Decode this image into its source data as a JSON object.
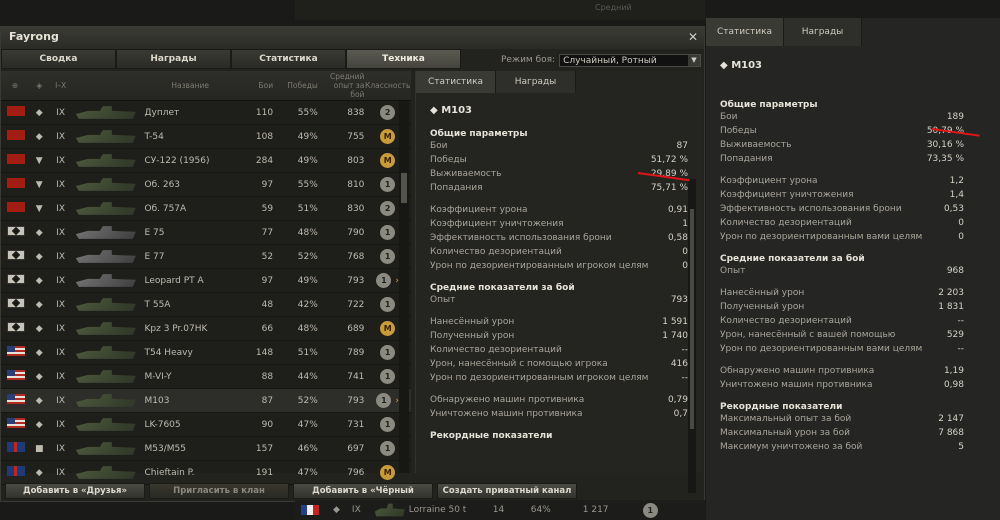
{
  "window": {
    "title": "Fayrong"
  },
  "tabs": [
    "Сводка",
    "Награды",
    "Статистика",
    "Техника"
  ],
  "mode": {
    "label": "Режим боя:",
    "value": "Случайный, Ротный"
  },
  "columns": {
    "tier": "I–X",
    "name": "Название",
    "battles": "Бои",
    "wins": "Победы",
    "xp": "Средний опыт за бой",
    "class": "Классность"
  },
  "tanks": [
    {
      "nation": "ussr",
      "type": "◆",
      "tier": "IX",
      "name": "Дуплет",
      "battles": "110",
      "wins": "55%",
      "xp": "838",
      "badge": "2",
      "selected": false,
      "arrow": false
    },
    {
      "nation": "ussr",
      "type": "◆",
      "tier": "IX",
      "name": "T-54",
      "battles": "108",
      "wins": "49%",
      "xp": "755",
      "badge": "M",
      "selected": false,
      "arrow": false
    },
    {
      "nation": "ussr",
      "type": "▼",
      "tier": "IX",
      "name": "СУ-122 (1956)",
      "battles": "284",
      "wins": "49%",
      "xp": "803",
      "badge": "M",
      "selected": false,
      "arrow": false
    },
    {
      "nation": "ussr",
      "type": "▼",
      "tier": "IX",
      "name": "Об. 263",
      "battles": "97",
      "wins": "55%",
      "xp": "810",
      "badge": "1",
      "selected": false,
      "arrow": false
    },
    {
      "nation": "ussr",
      "type": "▼",
      "tier": "IX",
      "name": "Об. 757А",
      "battles": "59",
      "wins": "51%",
      "xp": "830",
      "badge": "2",
      "selected": false,
      "arrow": false
    },
    {
      "nation": "ger",
      "type": "◆",
      "tier": "IX",
      "name": "E 75",
      "battles": "77",
      "wins": "48%",
      "xp": "790",
      "badge": "1",
      "selected": false,
      "arrow": false
    },
    {
      "nation": "ger",
      "type": "◆",
      "tier": "IX",
      "name": "E 77",
      "battles": "52",
      "wins": "52%",
      "xp": "768",
      "badge": "1",
      "selected": false,
      "arrow": false
    },
    {
      "nation": "ger",
      "type": "◆",
      "tier": "IX",
      "name": "Leopard PT A",
      "battles": "97",
      "wins": "49%",
      "xp": "793",
      "badge": "1",
      "selected": false,
      "arrow": true
    },
    {
      "nation": "ger",
      "type": "◆",
      "tier": "IX",
      "name": "T 55A",
      "battles": "48",
      "wins": "42%",
      "xp": "722",
      "badge": "1",
      "selected": false,
      "arrow": false
    },
    {
      "nation": "ger",
      "type": "◆",
      "tier": "IX",
      "name": "Kpz 3 Pr.07HK",
      "battles": "66",
      "wins": "48%",
      "xp": "689",
      "badge": "M",
      "selected": false,
      "arrow": false
    },
    {
      "nation": "usa",
      "type": "◆",
      "tier": "IX",
      "name": "T54 Heavy",
      "battles": "148",
      "wins": "51%",
      "xp": "789",
      "badge": "1",
      "selected": false,
      "arrow": false
    },
    {
      "nation": "usa",
      "type": "◆",
      "tier": "IX",
      "name": "M-VI-Y",
      "battles": "88",
      "wins": "44%",
      "xp": "741",
      "badge": "1",
      "selected": false,
      "arrow": false
    },
    {
      "nation": "usa",
      "type": "◆",
      "tier": "IX",
      "name": "M103",
      "battles": "87",
      "wins": "52%",
      "xp": "793",
      "badge": "1",
      "selected": true,
      "arrow": true
    },
    {
      "nation": "usa",
      "type": "◆",
      "tier": "IX",
      "name": "LK-7605",
      "battles": "90",
      "wins": "47%",
      "xp": "731",
      "badge": "1",
      "selected": false,
      "arrow": false
    },
    {
      "nation": "uk",
      "type": "■",
      "tier": "IX",
      "name": "M53/M55",
      "battles": "157",
      "wins": "46%",
      "xp": "697",
      "badge": "1",
      "selected": false,
      "arrow": false
    },
    {
      "nation": "uk",
      "type": "◆",
      "tier": "IX",
      "name": "Chieftain P.",
      "battles": "191",
      "wins": "47%",
      "xp": "796",
      "badge": "M",
      "selected": false,
      "arrow": false
    }
  ],
  "detail": {
    "tabs": [
      "Статистика",
      "Награды"
    ],
    "title": "M103",
    "sections": [
      {
        "title": "Общие параметры",
        "rows": [
          [
            "Бои",
            "87"
          ],
          [
            "Победы",
            "51,72 %"
          ],
          [
            "Выживаемость",
            "29,89 %"
          ],
          [
            "Попадания",
            "75,71 %"
          ],
          [
            "",
            ""
          ],
          [
            "Коэффициент урона",
            "0,91"
          ],
          [
            "Коэффициент уничтожения",
            "1"
          ],
          [
            "Эффективность использования брони",
            "0,58"
          ],
          [
            "Количество дезориентаций",
            "0"
          ],
          [
            "Урон по дезориентированным игроком целям",
            "0"
          ]
        ]
      },
      {
        "title": "Средние показатели за бой",
        "rows": [
          [
            "Опыт",
            "793"
          ],
          [
            "",
            ""
          ],
          [
            "Нанесённый урон",
            "1 591"
          ],
          [
            "Полученный урон",
            "1 740"
          ],
          [
            "Количество дезориентаций",
            "--"
          ],
          [
            "Урон, нанесённый с помощью игрока",
            "416"
          ],
          [
            "Урон по дезориентированным игроком целям",
            "--"
          ],
          [
            "",
            ""
          ],
          [
            "Обнаружено машин противника",
            "0,79"
          ],
          [
            "Уничтожено машин противника",
            "0,7"
          ]
        ]
      },
      {
        "title": "Рекордные показатели",
        "rows": []
      }
    ]
  },
  "buttons": [
    "Добавить в «Друзья»",
    "Пригласить в клан",
    "Добавить в «Чёрный список»",
    "Создать приватный канал"
  ],
  "right": {
    "tabs": [
      "Статистика",
      "Награды"
    ],
    "title": "M103",
    "sections": [
      {
        "title": "Общие параметры",
        "rows": [
          [
            "Бои",
            "189"
          ],
          [
            "Победы",
            "50,79 %"
          ],
          [
            "Выживаемость",
            "30,16 %"
          ],
          [
            "Попадания",
            "73,35 %"
          ],
          [
            "",
            ""
          ],
          [
            "Коэффициент урона",
            "1,2"
          ],
          [
            "Коэффициент уничтожения",
            "1,4"
          ],
          [
            "Эффективность использования брони",
            "0,53"
          ],
          [
            "Количество дезориентаций",
            "0"
          ],
          [
            "Урон по дезориентированным вами целям",
            "0"
          ]
        ]
      },
      {
        "title": "Средние показатели за бой",
        "rows": [
          [
            "Опыт",
            "968"
          ],
          [
            "",
            ""
          ],
          [
            "Нанесённый урон",
            "2 203"
          ],
          [
            "Полученный урон",
            "1 831"
          ],
          [
            "Количество дезориентаций",
            "--"
          ],
          [
            "Урон, нанесённый с вашей помощью",
            "529"
          ],
          [
            "Урон по дезориентированным вами целям",
            "--"
          ],
          [
            "",
            ""
          ],
          [
            "Обнаружено машин противника",
            "1,19"
          ],
          [
            "Уничтожено машин противника",
            "0,98"
          ]
        ]
      },
      {
        "title": "Рекордные показатели",
        "rows": [
          [
            "Максимальный опыт за бой",
            "2 147"
          ],
          [
            "Максимальный урон за бой",
            "7 868"
          ],
          [
            "Максимум уничтожено за бой",
            "5"
          ]
        ]
      }
    ]
  },
  "bgrow": {
    "tier": "IX",
    "name": "Lorraine 50 t",
    "battles": "14",
    "wins": "64%",
    "xp": "1 217"
  },
  "bgheader": "Средний"
}
